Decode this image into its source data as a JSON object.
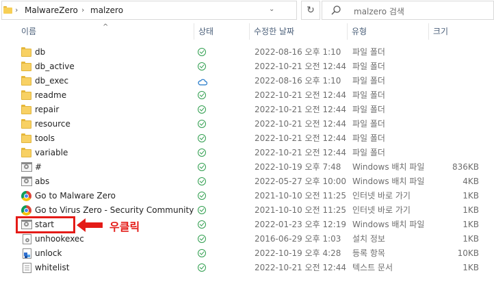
{
  "breadcrumb": {
    "items": [
      "MalwareZero",
      "malzero"
    ]
  },
  "search": {
    "placeholder": "malzero 검색"
  },
  "columns": {
    "name": "이름",
    "status": "상태",
    "date": "수정한 날짜",
    "type": "유형",
    "size": "크기"
  },
  "files": [
    {
      "name": "db",
      "icon": "folder-icon",
      "status": "synced",
      "date": "2022-08-16 오후 1:10",
      "type": "파일 폴더",
      "size": ""
    },
    {
      "name": "db_active",
      "icon": "folder-icon",
      "status": "synced",
      "date": "2022-10-21 오전 12:44",
      "type": "파일 폴더",
      "size": ""
    },
    {
      "name": "db_exec",
      "icon": "folder-icon",
      "status": "cloud",
      "date": "2022-08-16 오후 1:10",
      "type": "파일 폴더",
      "size": ""
    },
    {
      "name": "readme",
      "icon": "folder-icon",
      "status": "synced",
      "date": "2022-10-21 오전 12:44",
      "type": "파일 폴더",
      "size": ""
    },
    {
      "name": "repair",
      "icon": "folder-icon",
      "status": "synced",
      "date": "2022-10-21 오전 12:44",
      "type": "파일 폴더",
      "size": ""
    },
    {
      "name": "resource",
      "icon": "folder-icon",
      "status": "synced",
      "date": "2022-10-21 오전 12:44",
      "type": "파일 폴더",
      "size": ""
    },
    {
      "name": "tools",
      "icon": "folder-icon",
      "status": "synced",
      "date": "2022-10-21 오전 12:44",
      "type": "파일 폴더",
      "size": ""
    },
    {
      "name": "variable",
      "icon": "folder-icon",
      "status": "synced",
      "date": "2022-10-21 오전 12:44",
      "type": "파일 폴더",
      "size": ""
    },
    {
      "name": "#",
      "icon": "batch-file-icon",
      "status": "synced",
      "date": "2022-10-19 오후 7:48",
      "type": "Windows 배치 파일",
      "size": "836KB"
    },
    {
      "name": "abs",
      "icon": "batch-file-icon",
      "status": "synced",
      "date": "2022-05-27 오후 10:00",
      "type": "Windows 배치 파일",
      "size": "4KB"
    },
    {
      "name": "Go to Malware Zero",
      "icon": "internet-shortcut-icon",
      "status": "synced",
      "date": "2021-10-10 오전 11:25",
      "type": "인터넷 바로 가기",
      "size": "1KB"
    },
    {
      "name": "Go to Virus Zero - Security Community",
      "icon": "internet-shortcut-icon",
      "status": "synced",
      "date": "2021-10-10 오전 11:25",
      "type": "인터넷 바로 가기",
      "size": "1KB"
    },
    {
      "name": "start",
      "icon": "batch-file-icon",
      "status": "synced",
      "date": "2022-01-23 오후 12:19",
      "type": "Windows 배치 파일",
      "size": "1KB"
    },
    {
      "name": "unhookexec",
      "icon": "setup-info-icon",
      "status": "synced",
      "date": "2016-06-29 오후 1:03",
      "type": "설치 정보",
      "size": "1KB"
    },
    {
      "name": "unlock",
      "icon": "registry-file-icon",
      "status": "synced",
      "date": "2022-10-19 오후 4:28",
      "type": "등록 항목",
      "size": "10KB"
    },
    {
      "name": "whitelist",
      "icon": "text-file-icon",
      "status": "synced",
      "date": "2022-10-21 오전 12:44",
      "type": "텍스트 문서",
      "size": "1KB"
    }
  ],
  "annotation": {
    "label": "우클릭",
    "color": "#e41b17"
  },
  "colors": {
    "status_ok": "#2f9e4e",
    "status_cloud": "#1a73c8",
    "folder": "#f8d164"
  }
}
